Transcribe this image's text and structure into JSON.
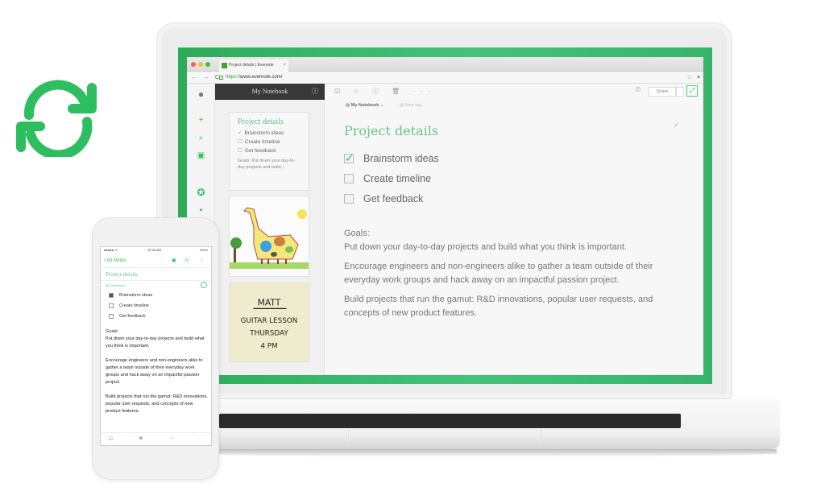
{
  "sync_icon": {
    "name": "sync-icon",
    "color": "#2dbe60"
  },
  "browser": {
    "tab_title": "Project details | Evernote",
    "url_scheme": "https://",
    "url_rest": "www.evernote.com/",
    "tab_close": "×",
    "star": "☆",
    "menu": "≡",
    "nav": "← → C"
  },
  "app": {
    "rail_icons": [
      "elephant-logo-icon",
      "new-note-icon",
      "search-icon",
      "work-chat-icon",
      "shortcuts-icon",
      "notes-icon"
    ],
    "notebook_header": "My Notebook",
    "notebook_info": "ⓘ",
    "note_cards": [
      {
        "title": "Project details",
        "items": [
          {
            "label": "Brainstorm ideas",
            "checked": true
          },
          {
            "label": "Create timeline",
            "checked": false
          },
          {
            "label": "Get feedback",
            "checked": false
          }
        ],
        "snippet": "Goals: Put down your day-to-day projects and build..."
      },
      {
        "type": "image",
        "description": "child drawing of a giraffe-dinosaur"
      },
      {
        "type": "handwritten",
        "lines": [
          "MATT",
          "GUITAR LESSON",
          "THURSDAY",
          "4 PM"
        ]
      }
    ]
  },
  "editor": {
    "toolbar": "☑ ☆ ⓘ 🗑 ···",
    "share_label": "Share",
    "notebook_label": "My Notebook",
    "notebook_caret": "⌄",
    "tag_placeholder": "New tag...",
    "title": "Project details",
    "done_check": "✓",
    "checklist": [
      {
        "label": "Brainstorm ideas",
        "checked": true
      },
      {
        "label": "Create timeline",
        "checked": false
      },
      {
        "label": "Get feedback",
        "checked": false
      }
    ],
    "goals_label": "Goals:",
    "paragraphs": [
      "Put down your day-to-day projects and build what you think is important.",
      "Encourage engineers and non-engineers alike to gather a team outside of their everyday work groups and hack away on an impactful passion project.",
      "Build projects that run the gamut: R&D innovations, popular user requests, and concepts of new product features."
    ]
  },
  "phone": {
    "carrier": "●●●●● ᯤ",
    "time": "12:30 AM",
    "battery": "100%",
    "back_label": "‹ All Notes",
    "title": "Project details",
    "notebook": "My Notebook ›",
    "checklist": [
      {
        "label": "Brainstorm ideas",
        "checked": true
      },
      {
        "label": "Create timeline",
        "checked": false
      },
      {
        "label": "Get feedback",
        "checked": false
      }
    ],
    "goals_label": "Goals:",
    "paragraphs": [
      "Put down your day-to-day projects and build what you think is important.",
      "Encourage engineers and non-engineers alike to gather a team outside of their everyday work groups and hack away on an impactful passion project.",
      "Build projects that run the gamut: R&D innovations, popular user requests, and concepts of new product features."
    ],
    "toolbar": [
      "☑",
      "◙",
      "♁",
      "···"
    ]
  }
}
